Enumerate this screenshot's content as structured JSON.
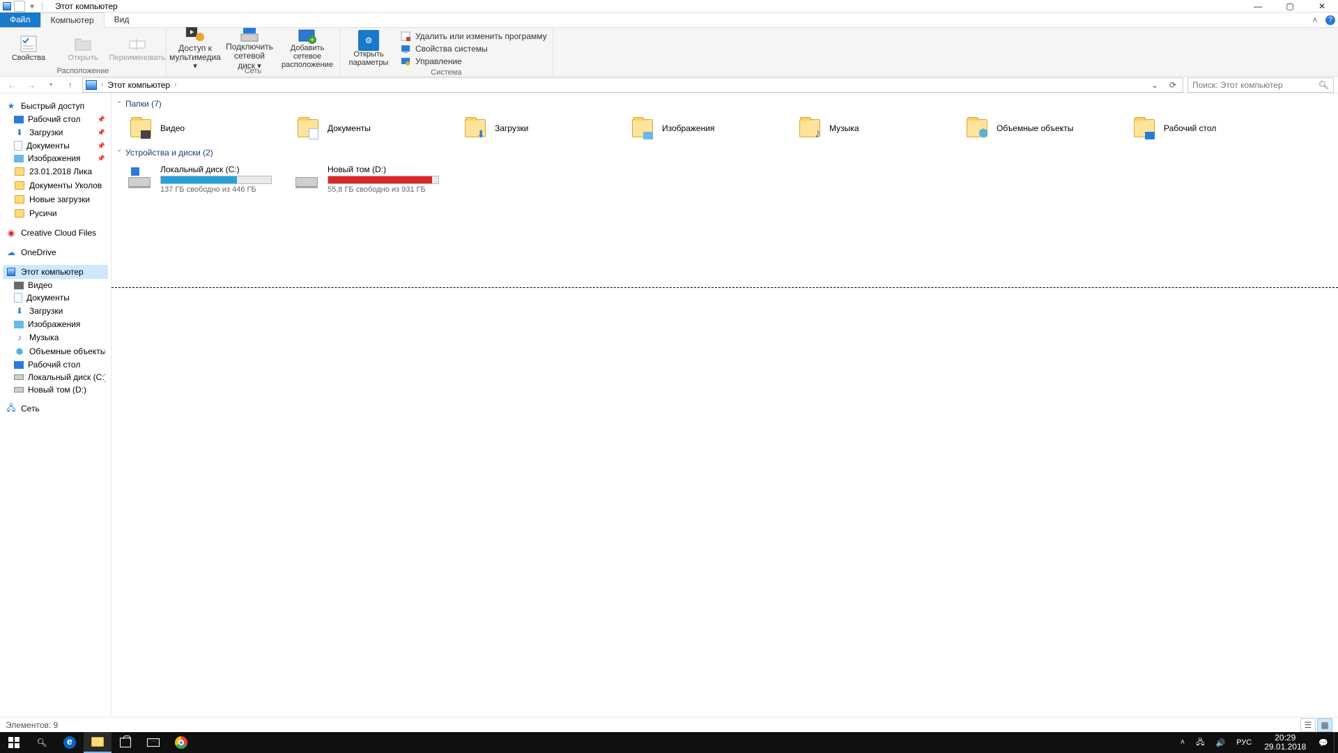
{
  "window": {
    "title": "Этот компьютер"
  },
  "tabs": {
    "file": "Файл",
    "computer": "Компьютер",
    "view": "Вид"
  },
  "ribbon": {
    "group_location": "Расположение",
    "group_network": "Сеть",
    "group_system": "Система",
    "properties": "Свойства",
    "open": "Открыть",
    "rename": "Переименовать",
    "media_access": "Доступ к мультимедиа",
    "map_drive": "Подключить сетевой диск",
    "add_network_location": "Добавить сетевое расположение",
    "open_settings": "Открыть параметры",
    "uninstall_program": "Удалить или изменить программу",
    "system_properties": "Свойства системы",
    "management": "Управление"
  },
  "breadcrumb": {
    "this_pc": "Этот компьютер"
  },
  "search": {
    "placeholder": "Поиск: Этот компьютер"
  },
  "nav": {
    "quick_access": "Быстрый доступ",
    "desktop": "Рабочий стол",
    "downloads": "Загрузки",
    "documents": "Документы",
    "pictures": "Изображения",
    "f1": "23.01.2018 Лика",
    "f2": "Документы Уколов",
    "f3": "Новые загрузки",
    "f4": "Русичи",
    "ccf": "Creative Cloud Files",
    "onedrive": "OneDrive",
    "this_pc": "Этот компьютер",
    "videos": "Видео",
    "documents2": "Документы",
    "downloads2": "Загрузки",
    "pictures2": "Изображения",
    "music": "Музыка",
    "objects3d": "Объемные объекты",
    "desktop2": "Рабочий стол",
    "drive_c": "Локальный диск (C:)",
    "drive_d": "Новый том (D:)",
    "network": "Сеть"
  },
  "sections": {
    "folders": "Папки (7)",
    "devices": "Устройства и диски (2)"
  },
  "folders": {
    "videos": "Видео",
    "documents": "Документы",
    "downloads": "Загрузки",
    "pictures": "Изображения",
    "music": "Музыка",
    "objects3d": "Объемные объекты",
    "desktop": "Рабочий стол"
  },
  "drives": {
    "c": {
      "name": "Локальный диск (C:)",
      "free": "137 ГБ свободно из 446 ГБ",
      "fill_pct": 69,
      "color": "#26a0da"
    },
    "d": {
      "name": "Новый том (D:)",
      "free": "55,8 ГБ свободно из 931 ГБ",
      "fill_pct": 94,
      "color": "#da2626"
    }
  },
  "status": {
    "items": "Элементов: 9"
  },
  "tray": {
    "lang": "РУС",
    "time": "20:29",
    "date": "29.01.2018"
  }
}
